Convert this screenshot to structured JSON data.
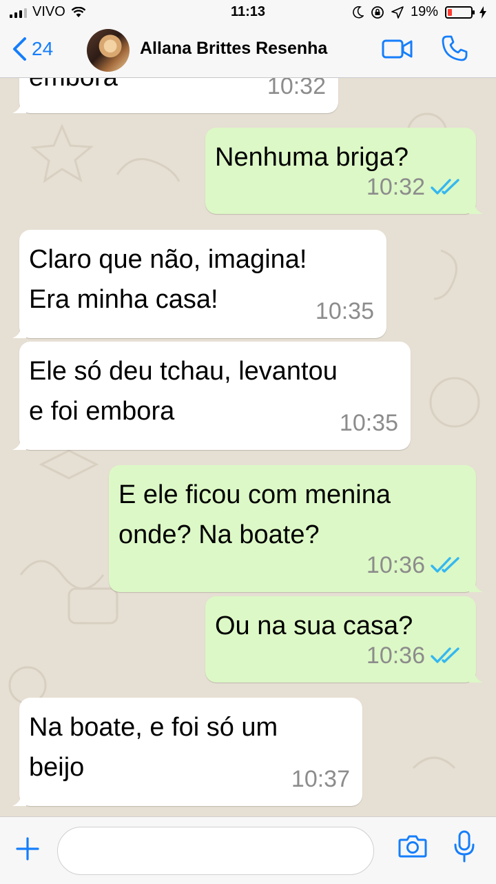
{
  "status_bar": {
    "carrier": "VIVO",
    "time": "11:13",
    "battery_percent": "19%"
  },
  "nav": {
    "back_count": "24",
    "contact_name": "Allana Brittes Resenha"
  },
  "messages": [
    {
      "direction": "in",
      "text": "embora",
      "time": "10:32"
    },
    {
      "direction": "out",
      "text": "Nenhuma briga?",
      "time": "10:32",
      "status": "read"
    },
    {
      "direction": "in",
      "text": "Claro que não, imagina!\nEra minha casa!",
      "time": "10:35"
    },
    {
      "direction": "in",
      "text": "Ele só deu tchau, levantou\ne foi embora",
      "time": "10:35"
    },
    {
      "direction": "out",
      "text": "E ele ficou com menina\nonde? Na boate?",
      "time": "10:36",
      "status": "read"
    },
    {
      "direction": "out",
      "text": "Ou na sua casa?",
      "time": "10:36",
      "status": "read"
    },
    {
      "direction": "in",
      "text": "Na boate, e foi só um\nbeijo",
      "time": "10:37"
    }
  ],
  "input": {
    "placeholder": ""
  },
  "colors": {
    "accent": "#157efb",
    "outgoing_bubble": "#dcf8c6",
    "incoming_bubble": "#ffffff",
    "read_ticks": "#34b7f1"
  },
  "icons": [
    "signal-icon",
    "wifi-icon",
    "moon-icon",
    "lock-rotation-icon",
    "location-icon",
    "battery-icon",
    "charging-icon",
    "chevron-left-icon",
    "video-call-icon",
    "phone-icon",
    "plus-icon",
    "camera-icon",
    "microphone-icon",
    "double-check-icon"
  ]
}
